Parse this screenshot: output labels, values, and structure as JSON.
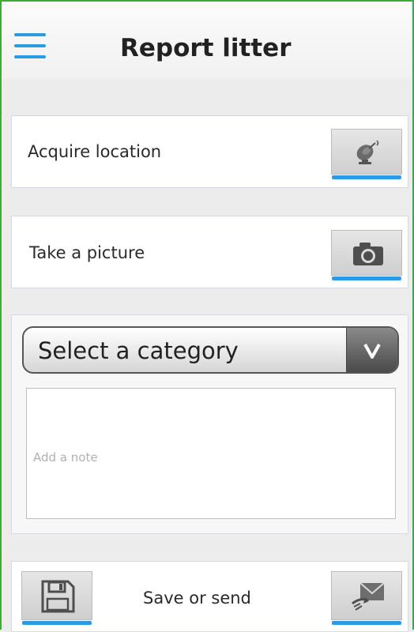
{
  "header": {
    "title": "Report litter",
    "menu_icon": "hamburger-menu-icon"
  },
  "location_card": {
    "label": "Acquire location",
    "icon": "satellite-dish-icon"
  },
  "picture_card": {
    "label": "Take a picture",
    "icon": "camera-icon"
  },
  "form": {
    "category_select": {
      "selected": "Select a category",
      "icon": "chevron-down-icon"
    },
    "note": {
      "placeholder": "Add a note",
      "value": ""
    }
  },
  "actions": {
    "label": "Save or send",
    "save_icon": "floppy-disk-icon",
    "send_icon": "send-envelope-icon"
  },
  "colors": {
    "accent": "#2d9be0",
    "frame": "#3daa3d"
  }
}
